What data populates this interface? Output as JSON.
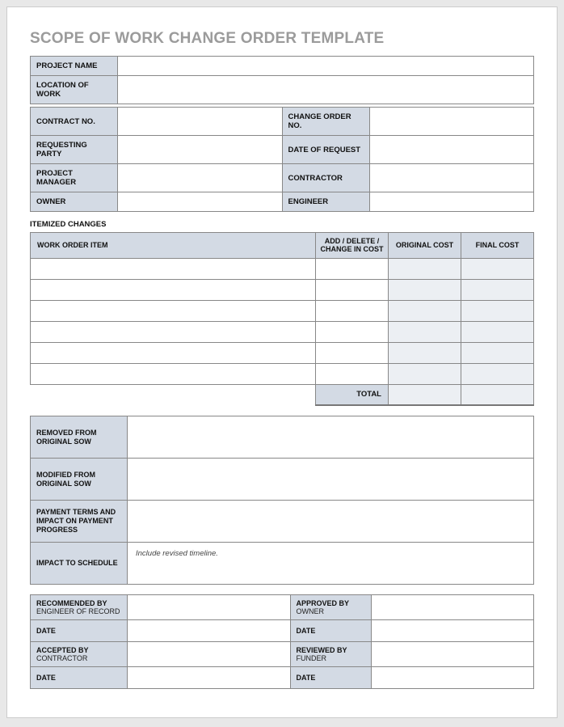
{
  "title": "SCOPE OF WORK CHANGE ORDER TEMPLATE",
  "header": {
    "project_name_label": "PROJECT NAME",
    "project_name_value": "",
    "location_label": "LOCATION OF WORK",
    "location_value": "",
    "contract_no_label": "CONTRACT NO.",
    "contract_no_value": "",
    "change_order_no_label": "CHANGE ORDER NO.",
    "change_order_no_value": "",
    "requesting_party_label": "REQUESTING PARTY",
    "requesting_party_value": "",
    "date_of_request_label": "DATE OF REQUEST",
    "date_of_request_value": "",
    "project_manager_label": "PROJECT MANAGER",
    "project_manager_value": "",
    "contractor_label": "CONTRACTOR",
    "contractor_value": "",
    "owner_label": "OWNER",
    "owner_value": "",
    "engineer_label": "ENGINEER",
    "engineer_value": ""
  },
  "itemized_section_title": "ITEMIZED CHANGES",
  "itemized": {
    "col_work_order": "WORK ORDER ITEM",
    "col_add_delete": "ADD / DELETE / CHANGE IN COST",
    "col_original_cost": "ORIGINAL COST",
    "col_final_cost": "FINAL COST",
    "rows": [
      {
        "item": "",
        "change": "",
        "orig": "",
        "final": ""
      },
      {
        "item": "",
        "change": "",
        "orig": "",
        "final": ""
      },
      {
        "item": "",
        "change": "",
        "orig": "",
        "final": ""
      },
      {
        "item": "",
        "change": "",
        "orig": "",
        "final": ""
      },
      {
        "item": "",
        "change": "",
        "orig": "",
        "final": ""
      },
      {
        "item": "",
        "change": "",
        "orig": "",
        "final": ""
      }
    ],
    "total_label": "TOTAL",
    "total_orig": "",
    "total_final": ""
  },
  "details": {
    "removed_label": "REMOVED FROM ORIGINAL SOW",
    "removed_value": "",
    "modified_label": "MODIFIED FROM ORIGINAL SOW",
    "modified_value": "",
    "payment_label": "PAYMENT TERMS AND IMPACT ON PAYMENT PROGRESS",
    "payment_value": "",
    "schedule_label": "IMPACT TO SCHEDULE",
    "schedule_value": "Include revised timeline."
  },
  "signatures": {
    "recommended_label": "RECOMMENDED BY",
    "recommended_sub": "ENGINEER OF RECORD",
    "recommended_value": "",
    "approved_label": "APPROVED BY",
    "approved_sub": "OWNER",
    "approved_value": "",
    "date_label": "DATE",
    "recommended_date": "",
    "approved_date": "",
    "accepted_label": "ACCEPTED BY",
    "accepted_sub": "CONTRACTOR",
    "accepted_value": "",
    "reviewed_label": "REVIEWED BY",
    "reviewed_sub": "FUNDER",
    "reviewed_value": "",
    "accepted_date": "",
    "reviewed_date": ""
  }
}
